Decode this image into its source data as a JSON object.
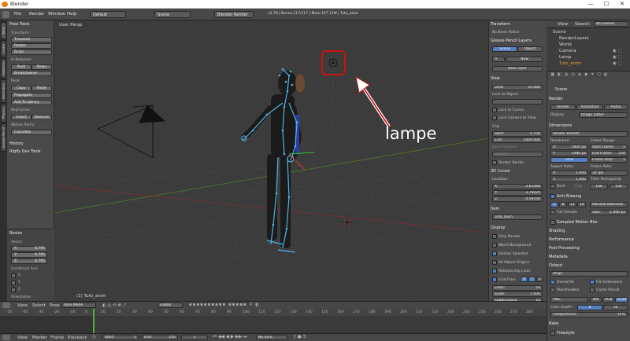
{
  "window": {
    "title": "Blender",
    "min": "—",
    "max": "☐",
    "close": "✕"
  },
  "menubar": {
    "items": [
      "File",
      "Render",
      "Window",
      "Help"
    ],
    "screen_layout": "Default",
    "scene": "Scene",
    "engine": "Blender Render",
    "stats": "v2.78 | Bones:117/117 | Mem:157.11M | Tuto_anim"
  },
  "left_tabs": [
    "Tools",
    "Create",
    "Relations",
    "Animation",
    "Physics",
    "Grease Pencil"
  ],
  "toolshelf": {
    "panel_title": "Pose Tools",
    "transform_label": "Transform:",
    "transform_buttons": [
      "Translate",
      "Rotate",
      "Scale"
    ],
    "inbetween_label": "In-Between:",
    "push": "Push",
    "relax": "Relax",
    "breakdowner": "Breakdowner",
    "pose_label": "Pose:",
    "copy": "Copy",
    "paste": "Paste",
    "propagate": "Propagate",
    "add_to_library": "Add To Library",
    "keyframes_label": "Keyframes:",
    "insert": "Insert",
    "remove": "Remove",
    "motion_paths_label": "Motion Paths:",
    "calculate": "Calculate",
    "history": "History",
    "rigify": "Rigify Dev Tools",
    "resize_title": "Resize",
    "vector_label": "Vector",
    "vx": "X:",
    "vx_val": "0.795",
    "vy": "Y:",
    "vy_val": "0.795",
    "vz": "Z:",
    "vz_val": "0.795",
    "constraint_label": "Constraint Axis",
    "cx": "X",
    "cy": "Y",
    "cz": "Z",
    "orientation": "Orientation"
  },
  "viewport": {
    "view_label": "User Persp",
    "object_label": "(1) Tuto_anim",
    "annotation": "lampe",
    "highlight_color": "#cc1111"
  },
  "props": {
    "transform": "Transform",
    "no_bone": "No Bone Active",
    "grease": "Grease Pencil Layers",
    "scene_tab": "Scene",
    "object_tab": "Object",
    "new": "New",
    "new_layer": "New Layer",
    "view": "View",
    "lens": "Lens:",
    "lens_val": "35.000",
    "lock_to_object": "Lock to Object:",
    "lock_cursor": "Lock to Cursor",
    "lock_camera": "Lock Camera to View",
    "clip": "Clip:",
    "clip_start": "Start:",
    "clip_start_val": "0.100",
    "clip_end": "End:",
    "clip_end_val": "1000.000",
    "local_camera": "Local Camera:",
    "camera_field": "Camera",
    "render_border": "Render Border",
    "cursor_3d": "3D Cursor",
    "location": "Location:",
    "lx": "X:",
    "lx_val": "3.61468",
    "ly": "Y:",
    "ly_val": "3.76020",
    "lz": "Z:",
    "lz_val": "0.59256",
    "item": "Item",
    "item_name": "Tuto_anim",
    "display": "Display",
    "only_render": "Only Render",
    "world_bg": "World Background",
    "outline_selected": "Outline Selected",
    "all_origins": "All Object Origins",
    "relationship_lines": "Relationship Lines",
    "grid_floor": "Grid Floor",
    "gx": "X",
    "gy": "Y",
    "gz": "Z",
    "lines": "Lines:",
    "lines_val": "16",
    "scale": "Scale:",
    "scale_val": "1.000",
    "subdiv": "Subdivisions:",
    "subdiv_val": "10"
  },
  "outliner": {
    "view": "View",
    "search": "Search",
    "filter": "All Scenes",
    "items": [
      "Scene",
      "RenderLayers",
      "World",
      "Camera",
      "Lamp",
      "Tuto_anim"
    ]
  },
  "render": {
    "scene_label": "Scene",
    "render_panel": "Render",
    "render_btn": "Render",
    "animation_btn": "Animation",
    "audio_btn": "Audio",
    "display": "Display:",
    "display_val": "Image Editor",
    "dimensions": "Dimensions",
    "presets": "Render Presets",
    "resolution": "Resolution:",
    "rx": "X:",
    "rx_val": "1920 px",
    "ry": "Y:",
    "ry_val": "1080 px",
    "pct": "50%",
    "frame_range": "Frame Range:",
    "start_frame": "Start Frame:",
    "start_frame_val": "1",
    "end_frame": "End Frame:",
    "end_frame_val": "250",
    "frame_step": "Frame Step:",
    "frame_step_val": "1",
    "aspect": "Aspect Ratio:",
    "ax": "X:",
    "ax_val": "1.000",
    "ay": "Y:",
    "ay_val": "1.000",
    "frame_rate": "Frame Rate:",
    "fps": "24 fps",
    "time_remap": "Time Remapping:",
    "tr_old": "100",
    "tr_new": "100",
    "border": "Bord",
    "crop": "Crop",
    "anti_alias": "Anti-Aliasing",
    "aa_samples": [
      "5",
      "8",
      "11",
      "16"
    ],
    "aa_filter": "Mitchell-Netravali",
    "full_sample": "Full Sample",
    "size": "Size:",
    "size_val": "1.000 px",
    "motion_blur": "Sampled Motion Blur",
    "shading": "Shading",
    "performance": "Performance",
    "post": "Post Processing",
    "metadata": "Metadata",
    "output": "Output",
    "output_path": "/tmp\\",
    "overwrite": "Overwrite",
    "file_ext": "File Extensions",
    "placeholders": "Placeholders",
    "cache_result": "Cache Result",
    "format": "PNG",
    "bw": "BW",
    "rgb": "RGB",
    "rgba": "RGBA",
    "color_depth": "Color Depth:",
    "cd8": "8",
    "cd16": "16",
    "compression": "Compression:",
    "comp_val": "15%",
    "bake": "Bake",
    "freestyle": "Freestyle"
  },
  "viewheader": {
    "view": "View",
    "select": "Select",
    "pose": "Pose",
    "mode": "Pose Mode",
    "pivot": "Global"
  },
  "timeline": {
    "ticks": [
      "-50",
      "-40",
      "-30",
      "-20",
      "-10",
      "0",
      "10",
      "20",
      "30",
      "40",
      "50",
      "60",
      "70",
      "80",
      "90",
      "100",
      "110",
      "120",
      "130",
      "140",
      "150",
      "160",
      "170",
      "180",
      "190",
      "200",
      "210",
      "220",
      "230",
      "240",
      "250",
      "260",
      "270",
      "280"
    ],
    "view": "View",
    "marker": "Marker",
    "frame": "Frame",
    "playback": "Playback",
    "start": "Start:",
    "start_val": "1",
    "end": "End:",
    "end_val": "250",
    "current": "1",
    "sync": "No Sync"
  }
}
